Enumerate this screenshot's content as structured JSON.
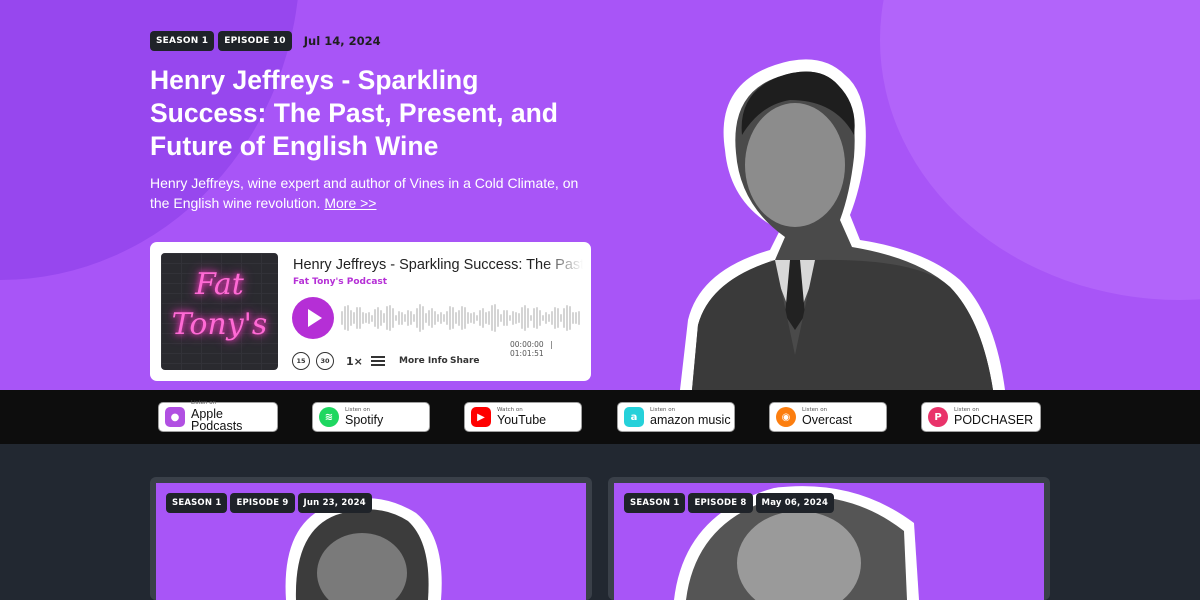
{
  "hero": {
    "season": "SEASON 1",
    "episode": "EPISODE 10",
    "date": "Jul 14, 2024",
    "title": "Henry Jeffreys - Sparkling Success: The Past, Present, and Future of English Wine",
    "description": "Henry Jeffreys, wine expert and author of Vines in a Cold Climate, on the English wine revolution.",
    "more_link": "More >>"
  },
  "player": {
    "cover_text": "Fat Tony's",
    "episode_title": "Henry Jeffreys - Sparkling Success: The Past, Present, and Future of English Wine",
    "podcast_name": "Fat Tony's Podcast",
    "time_current": "00:00:00",
    "time_total": "01:01:51",
    "skip_back": "15",
    "skip_forward": "30",
    "speed": "1×",
    "more_info": "More Info",
    "share": "Share",
    "accent": "#b52fd6"
  },
  "platforms": [
    {
      "small": "Listen on",
      "big": "Apple Podcasts",
      "icon": "apple-podcasts-icon",
      "color": "#b150e2"
    },
    {
      "small": "Listen on",
      "big": "Spotify",
      "icon": "spotify-icon",
      "color": "#1ed760"
    },
    {
      "small": "Watch on",
      "big": "YouTube",
      "icon": "youtube-icon",
      "color": "#ff0000"
    },
    {
      "small": "Listen on",
      "big": "amazon music",
      "icon": "amazon-music-icon",
      "color": "#25d1da"
    },
    {
      "small": "Listen on",
      "big": "Overcast",
      "icon": "overcast-icon",
      "color": "#fc7e0f"
    },
    {
      "small": "Listen on",
      "big": "PODCHASER",
      "icon": "podchaser-icon",
      "color": "#e9336a"
    }
  ],
  "episodes": [
    {
      "season": "SEASON 1",
      "episode": "EPISODE 9",
      "date": "Jun 23, 2024"
    },
    {
      "season": "SEASON 1",
      "episode": "EPISODE 8",
      "date": "May 06, 2024"
    }
  ],
  "colors": {
    "hero_bg": "#a855f7",
    "bar_bg": "#0d0d0d",
    "page_bg": "#222831"
  }
}
